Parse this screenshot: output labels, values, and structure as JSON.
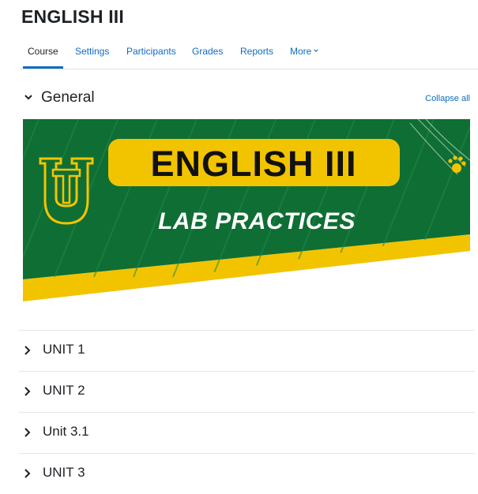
{
  "course": {
    "title": "ENGLISH III"
  },
  "tabs": [
    {
      "label": "Course",
      "active": true
    },
    {
      "label": "Settings"
    },
    {
      "label": "Participants"
    },
    {
      "label": "Grades"
    },
    {
      "label": "Reports"
    },
    {
      "label": "More"
    }
  ],
  "section": {
    "title": "General",
    "collapse_label": "Collapse all",
    "banner": {
      "title": "ENGLISH III",
      "subtitle": "LAB PRACTICES",
      "logo_letters": "UT",
      "colors": {
        "green": "#0f6e34",
        "gold": "#f2c400",
        "dark": "#111111"
      }
    }
  },
  "units": [
    {
      "label": "UNIT 1"
    },
    {
      "label": "UNIT 2"
    },
    {
      "label": "Unit 3.1"
    },
    {
      "label": "UNIT 3"
    }
  ],
  "theme": {
    "link": "#0f6cbf",
    "text": "#1d2125",
    "border": "#dee2e6"
  }
}
